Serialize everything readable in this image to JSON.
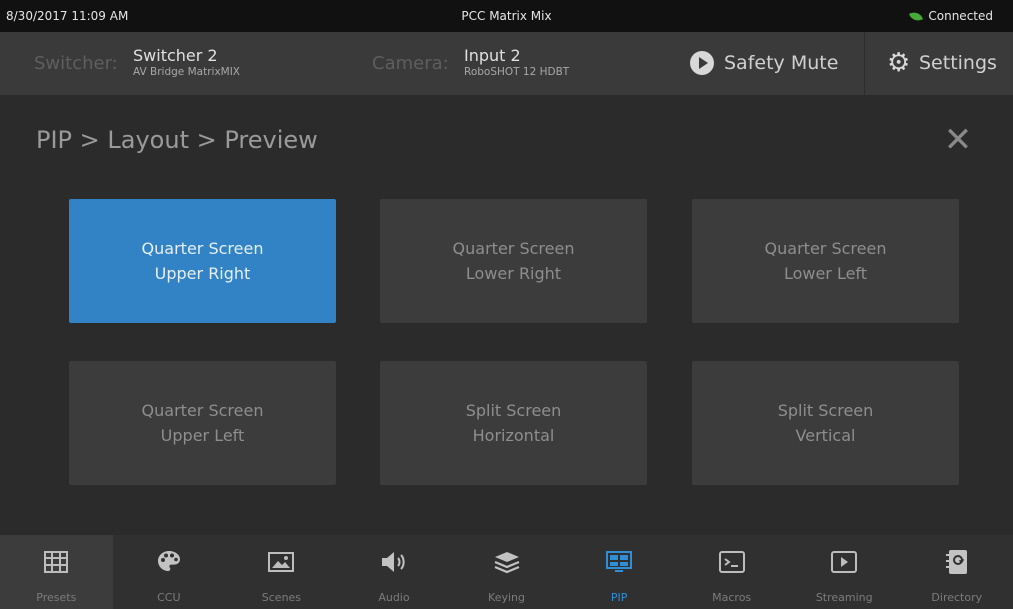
{
  "status": {
    "datetime": "8/30/2017 11:09 AM",
    "app_title": "PCC Matrix Mix",
    "connection": "Connected"
  },
  "header": {
    "switcher_key": "Switcher:",
    "switcher_name": "Switcher 2",
    "switcher_model": "AV Bridge MatrixMIX",
    "camera_key": "Camera:",
    "camera_input": "Input 2",
    "camera_model": "RoboSHOT 12 HDBT",
    "safety_mute_label": "Safety Mute",
    "settings_label": "Settings"
  },
  "main": {
    "breadcrumb": "PIP > Layout > Preview",
    "close_glyph": "✕",
    "tiles": [
      {
        "line1": "Quarter Screen",
        "line2": "Upper Right",
        "selected": true
      },
      {
        "line1": "Quarter Screen",
        "line2": "Lower Right",
        "selected": false
      },
      {
        "line1": "Quarter Screen",
        "line2": "Lower Left",
        "selected": false
      },
      {
        "line1": "Quarter Screen",
        "line2": "Upper Left",
        "selected": false
      },
      {
        "line1": "Split Screen",
        "line2": "Horizontal",
        "selected": false
      },
      {
        "line1": "Split Screen",
        "line2": "Vertical",
        "selected": false
      }
    ]
  },
  "nav": {
    "items": [
      {
        "label": "Presets",
        "icon": "grid-icon"
      },
      {
        "label": "CCU",
        "icon": "palette-icon"
      },
      {
        "label": "Scenes",
        "icon": "picture-icon"
      },
      {
        "label": "Audio",
        "icon": "speaker-icon"
      },
      {
        "label": "Keying",
        "icon": "layers-icon"
      },
      {
        "label": "PIP",
        "icon": "pip-icon"
      },
      {
        "label": "Macros",
        "icon": "terminal-icon"
      },
      {
        "label": "Streaming",
        "icon": "play-icon"
      },
      {
        "label": "Directory",
        "icon": "contacts-icon"
      }
    ],
    "active": "PIP"
  },
  "colors": {
    "accent": "#3283c5",
    "nav_active": "#2f8fd6",
    "connected": "#47a93a",
    "background": "#2b2b2b",
    "header_bg": "#3a3a3a",
    "tile_bg": "#3c3c3c"
  }
}
